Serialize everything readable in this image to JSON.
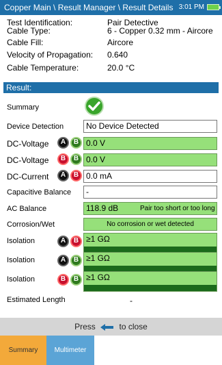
{
  "header": {
    "breadcrumb": "Copper Main \\ Result Manager \\ Result Details",
    "time": "3:01 PM"
  },
  "info": {
    "test_identification_label": "Test Identification:",
    "test_identification_value": "Pair Detective",
    "cable_type_label": "Cable Type:",
    "cable_type_value": "6 - Copper 0.32 mm - Aircore",
    "cable_fill_label": "Cable Fill:",
    "cable_fill_value": "Aircore",
    "vop_label": "Velocity of Propagation:",
    "vop_value": "0.640",
    "temperature_label": "Cable Temperature:",
    "temperature_value": "20.0 °C"
  },
  "result": {
    "section_title": "Result:",
    "summary_label": "Summary",
    "device_detection_label": "Device Detection",
    "device_detection_value": "No Device Detected",
    "dc_voltage_ab_label": "DC-Voltage",
    "dc_voltage_ab_value": "0.0 V",
    "dc_voltage_bb_label": "DC-Voltage",
    "dc_voltage_bb_value": "0.0 V",
    "dc_current_label": "DC-Current",
    "dc_current_value": "0.0 mA",
    "capacitive_balance_label": "Capacitive Balance",
    "capacitive_balance_value": "-",
    "ac_balance_label": "AC Balance",
    "ac_balance_value": "118.9 dB",
    "ac_balance_note": "Pair too short or too long",
    "corrosion_label": "Corrosion/Wet",
    "corrosion_value": "No corrosion or wet detected",
    "isolation1_label": "Isolation",
    "isolation1_value": "≥1 GΩ",
    "isolation2_label": "Isolation",
    "isolation2_value": "≥1 GΩ",
    "isolation3_label": "Isolation",
    "isolation3_value": "≥1 GΩ",
    "estimated_length_label": "Estimated Length",
    "estimated_length_value": "-"
  },
  "badges": {
    "a": "A",
    "b": "B"
  },
  "footer": {
    "press_text": "Press",
    "close_text": "to close"
  },
  "tabs": {
    "summary": "Summary",
    "multimeter": "Multimeter"
  },
  "colors": {
    "header_blue": "#1f6fa8",
    "pass_green": "#96e07a",
    "wire_black": "#111111",
    "wire_green": "#2f7a1f",
    "wire_red": "#c8102e",
    "tab_active": "#f3a93a",
    "tab_inactive": "#5ba4d6"
  },
  "icons": [
    "battery-icon",
    "checkmark-icon",
    "back-arrow-icon"
  ]
}
